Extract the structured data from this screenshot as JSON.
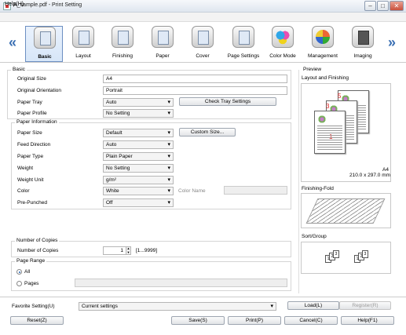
{
  "window": {
    "title": "A_sample.pdf - Print Setting",
    "minimize": "–",
    "maximize": "□",
    "close": "✕"
  },
  "menu": {
    "help": "Help(H)"
  },
  "ribbon": {
    "prev": "«",
    "next": "»",
    "tabs": [
      {
        "label": "Basic",
        "icon": "basic-icon"
      },
      {
        "label": "Layout",
        "icon": "layout-icon"
      },
      {
        "label": "Finishing",
        "icon": "finishing-icon"
      },
      {
        "label": "Paper",
        "icon": "paper-icon"
      },
      {
        "label": "Cover",
        "icon": "cover-icon"
      },
      {
        "label": "Page Settings",
        "icon": "page-settings-icon"
      },
      {
        "label": "Color Mode",
        "icon": "color-mode-icon"
      },
      {
        "label": "Management",
        "icon": "management-icon"
      },
      {
        "label": "Imaging",
        "icon": "imaging-icon"
      }
    ]
  },
  "basic": {
    "title": "Basic",
    "original_size": {
      "label": "Original Size",
      "value": "A4"
    },
    "original_orientation": {
      "label": "Original Orientation",
      "value": "Portrait"
    },
    "paper_tray": {
      "label": "Paper Tray",
      "value": "Auto"
    },
    "check_tray": "Check Tray Settings",
    "paper_profile": {
      "label": "Paper Profile",
      "value": "No Setting"
    }
  },
  "paper_info": {
    "title": "Paper Information",
    "paper_size": {
      "label": "Paper Size",
      "value": "Default"
    },
    "custom_size": "Custom Size...",
    "feed_direction": {
      "label": "Feed Direction",
      "value": "Auto"
    },
    "paper_type": {
      "label": "Paper Type",
      "value": "Plain Paper"
    },
    "weight": {
      "label": "Weight",
      "value": "No Setting"
    },
    "weight_unit": {
      "label": "Weight Unit",
      "value": "g/m²"
    },
    "color": {
      "label": "Color",
      "value": "White"
    },
    "color_name": {
      "label": "Color Name",
      "value": ""
    },
    "pre_punched": {
      "label": "Pre-Punched",
      "value": "Off"
    }
  },
  "copies": {
    "title": "Number of Copies",
    "label": "Number of Copies",
    "value": "1",
    "range": "[1...9999]"
  },
  "page_range": {
    "title": "Page Range",
    "all": "All",
    "pages": "Pages",
    "pages_value": ""
  },
  "preview": {
    "title": "Preview",
    "layout_title": "Layout and Finishing",
    "page_numbers": [
      "5",
      "3",
      "1"
    ],
    "paper": "A4",
    "dimensions": "210.0 x 297.0 mm",
    "finishing_fold": "Finishing-Fold",
    "sort_group": "Sort/Group",
    "sort_pages": [
      "1",
      "2",
      "3"
    ]
  },
  "favorite": {
    "label": "Favorite Setting(U)",
    "value": "Current settings",
    "load": "Load(L)",
    "register": "Register(R)"
  },
  "footer": {
    "reset": "Reset(Z)",
    "save": "Save(S)",
    "print": "Print(P)",
    "cancel": "Cancel(C)",
    "help": "Help(F1)"
  }
}
